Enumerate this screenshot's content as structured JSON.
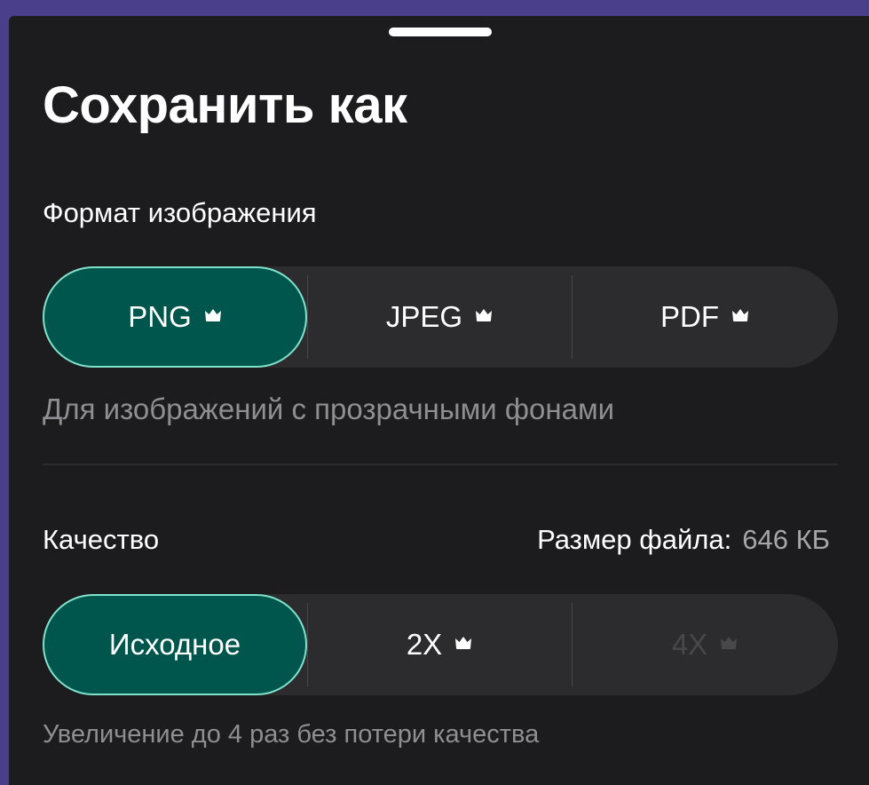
{
  "sheet": {
    "title": "Сохранить как"
  },
  "format": {
    "label": "Формат изображения",
    "options": [
      {
        "label": "PNG",
        "icon": "crown-icon",
        "selected": true,
        "enabled": true
      },
      {
        "label": "JPEG",
        "icon": "crown-icon",
        "selected": false,
        "enabled": true
      },
      {
        "label": "PDF",
        "icon": "crown-icon",
        "selected": false,
        "enabled": true
      }
    ],
    "hint": "Для изображений с прозрачными фонами"
  },
  "quality": {
    "label": "Качество",
    "filesize_label": "Размер файла:",
    "filesize_value": "646 КБ",
    "options": [
      {
        "label": "Исходное",
        "icon": null,
        "selected": true,
        "enabled": true
      },
      {
        "label": "2X",
        "icon": "crown-icon",
        "selected": false,
        "enabled": true
      },
      {
        "label": "4X",
        "icon": "crown-icon",
        "selected": false,
        "enabled": false
      }
    ],
    "hint": "Увеличение до 4 раз без потери качества"
  },
  "colors": {
    "background": "#4a3f8a",
    "sheet": "#1c1c1e",
    "segment_track": "#2c2c2e",
    "selected_fill": "#00564d",
    "selected_border": "#7fe3cc",
    "hint_text": "#8e8e93",
    "disabled_text": "#48484a"
  }
}
